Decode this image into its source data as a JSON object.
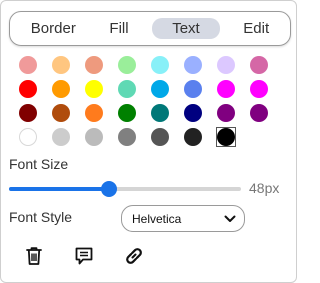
{
  "tabs": [
    {
      "label": "Border",
      "active": false
    },
    {
      "label": "Fill",
      "active": false
    },
    {
      "label": "Text",
      "active": true
    },
    {
      "label": "Edit",
      "active": false
    }
  ],
  "palette": [
    [
      "#f09a9a",
      "#ffc680",
      "#ee9a7e",
      "#9aee9a",
      "#88f0f8",
      "#9ab0ff",
      "#dcc8ff",
      "#d567a6"
    ],
    [
      "#ff0000",
      "#ff9a00",
      "#ffff00",
      "#5fd9b4",
      "#00a8e8",
      "#5a80ee",
      "#ff00ff",
      "#ff00ff"
    ],
    [
      "#800000",
      "#b04c0c",
      "#ff7b1d",
      "#008000",
      "#007878",
      "#000080",
      "#800080",
      "#800080"
    ],
    [
      "#ffffff",
      "#cccccc",
      "#bbbbbb",
      "#808080",
      "#555555",
      "#222222",
      "#000000",
      ""
    ]
  ],
  "selected_color": "#000000",
  "font_size": {
    "label": "Font Size",
    "value_text": "48px",
    "fraction": 0.43
  },
  "font_style": {
    "label": "Font Style",
    "selected": "Helvetica"
  },
  "actions": [
    {
      "icon": "trash-icon"
    },
    {
      "icon": "comment-icon"
    },
    {
      "icon": "link-icon"
    }
  ],
  "colors": {
    "accent": "#1a73e8",
    "tab_active_bg": "#d5d9e3"
  }
}
